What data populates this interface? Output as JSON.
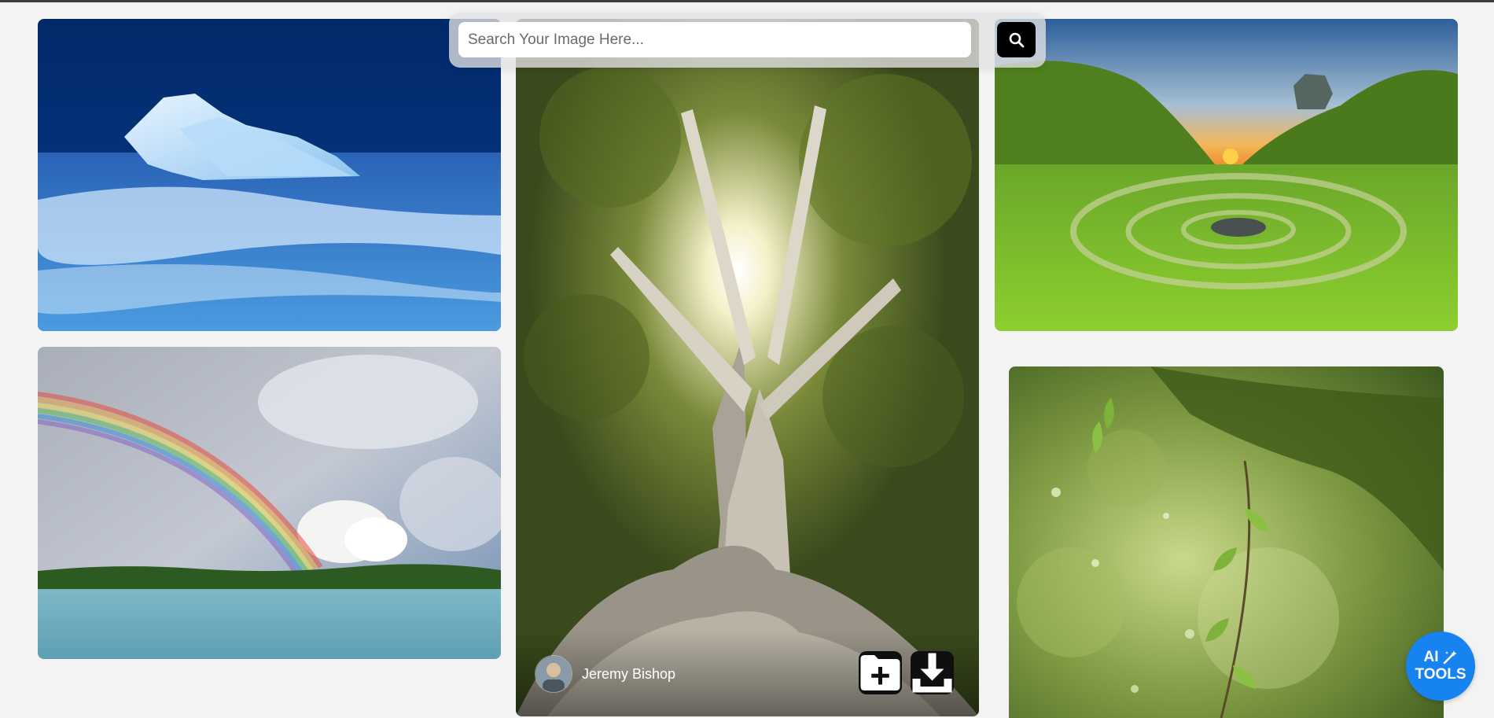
{
  "search": {
    "placeholder": "Search Your Image Here...",
    "button_icon": "search-icon"
  },
  "gallery": {
    "images": [
      {
        "subject": "iceberg on blue water"
      },
      {
        "subject": "rainbow over lake and clouds"
      },
      {
        "subject": "large tree with sun through branches"
      },
      {
        "subject": "green valley with stone circles at sunset"
      },
      {
        "subject": "green leaves with bokeh"
      }
    ]
  },
  "featured": {
    "author_name": "Jeremy Bishop",
    "collect_icon": "add-folder-icon",
    "download_icon": "download-icon"
  },
  "ai_tools": {
    "line1": "AI",
    "line2": "TOOLS",
    "icon": "magic-wand-icon",
    "color": "#1683f0"
  }
}
